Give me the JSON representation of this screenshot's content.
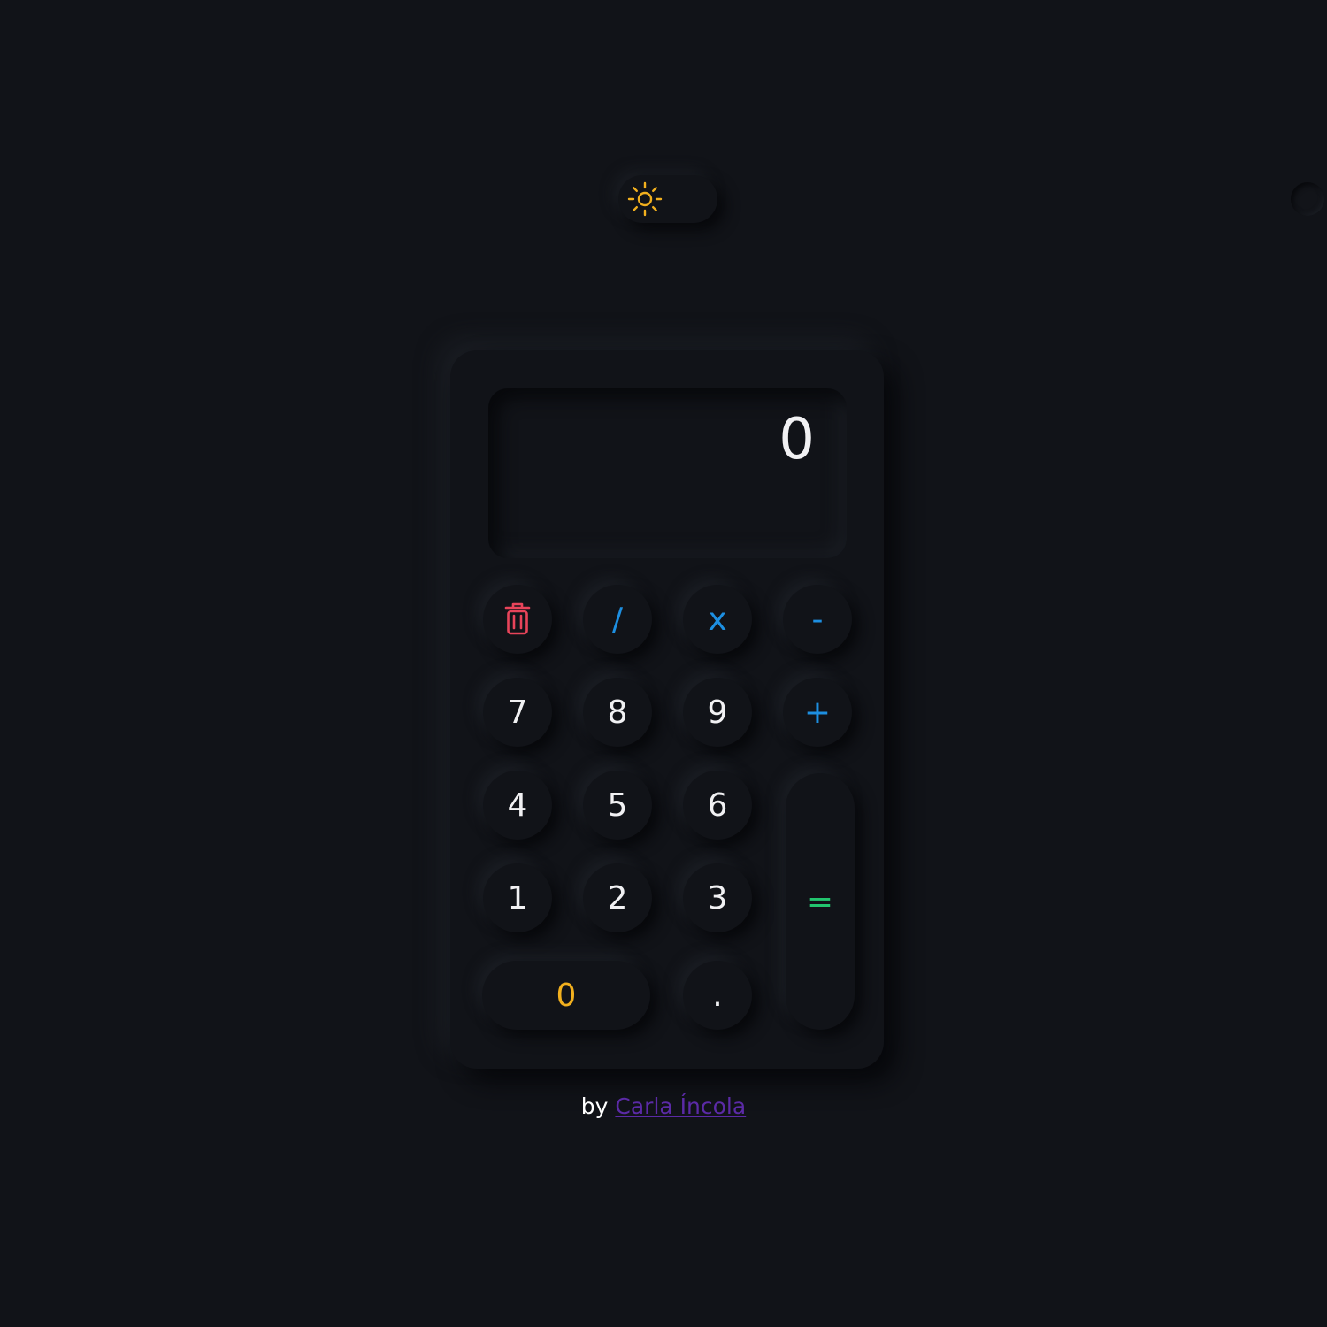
{
  "theme_toggle": {
    "icon": "sun-icon",
    "state": "dark",
    "icon_color": "#f2b01e"
  },
  "display": {
    "value": "0"
  },
  "keys": {
    "clear": {
      "icon": "trash-icon",
      "color": "#e8445a"
    },
    "divide": "/",
    "multiply": "x",
    "subtract": "-",
    "seven": "7",
    "eight": "8",
    "nine": "9",
    "add": "+",
    "four": "4",
    "five": "5",
    "six": "6",
    "one": "1",
    "two": "2",
    "three": "3",
    "equals": "=",
    "zero": "0",
    "decimal": "."
  },
  "colors": {
    "background": "#111318",
    "operator": "#1d8fe1",
    "equals": "#22c56e",
    "zero": "#f2b01e",
    "link": "#5b2aa6"
  },
  "footer": {
    "by": "by",
    "author": "Carla Íncola"
  }
}
